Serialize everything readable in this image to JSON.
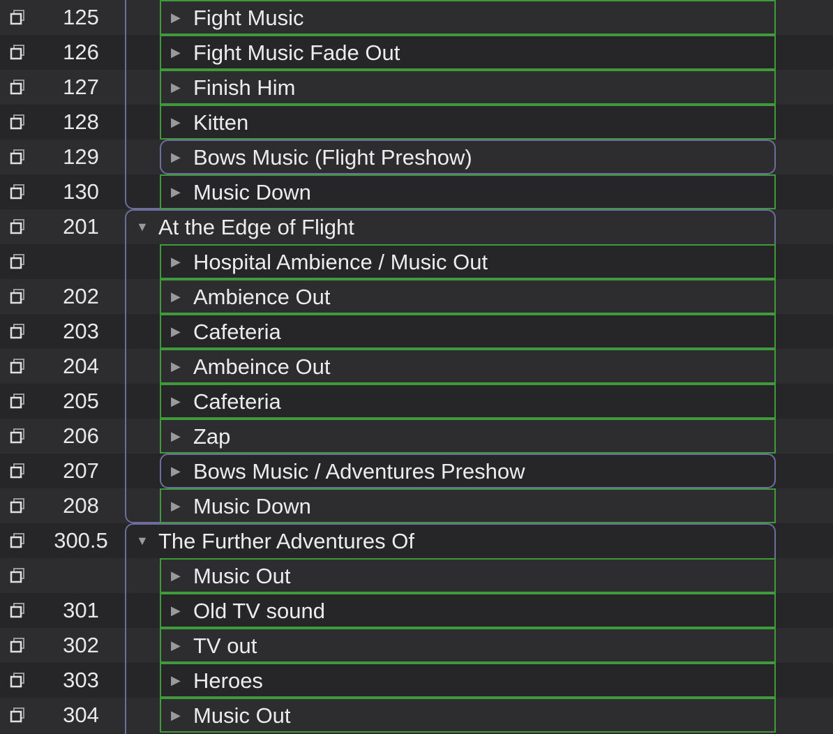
{
  "cues": [
    {
      "number": "125",
      "name": "Fight Music",
      "kind": "child",
      "expanded": false
    },
    {
      "number": "126",
      "name": "Fight Music Fade Out",
      "kind": "child",
      "expanded": false
    },
    {
      "number": "127",
      "name": "Finish Him",
      "kind": "child",
      "expanded": false
    },
    {
      "number": "128",
      "name": "Kitten",
      "kind": "child",
      "expanded": false
    },
    {
      "number": "129",
      "name": "Bows Music (Flight Preshow)",
      "kind": "nested-group",
      "expanded": false
    },
    {
      "number": "130",
      "name": "Music Down",
      "kind": "child",
      "expanded": false
    },
    {
      "number": "201",
      "name": "At the Edge of Flight",
      "kind": "group-header",
      "expanded": true
    },
    {
      "number": "",
      "name": "Hospital Ambience / Music Out",
      "kind": "child",
      "expanded": false
    },
    {
      "number": "202",
      "name": "Ambience Out",
      "kind": "child",
      "expanded": false
    },
    {
      "number": "203",
      "name": "Cafeteria",
      "kind": "child",
      "expanded": false
    },
    {
      "number": "204",
      "name": "Ambeince Out",
      "kind": "child",
      "expanded": false
    },
    {
      "number": "205",
      "name": "Cafeteria",
      "kind": "child",
      "expanded": false
    },
    {
      "number": "206",
      "name": "Zap",
      "kind": "child",
      "expanded": false
    },
    {
      "number": "207",
      "name": "Bows Music / Adventures Preshow",
      "kind": "nested-group",
      "expanded": false
    },
    {
      "number": "208",
      "name": "Music Down",
      "kind": "child",
      "expanded": false
    },
    {
      "number": "300.5",
      "name": "The Further Adventures Of",
      "kind": "group-header",
      "expanded": true
    },
    {
      "number": "",
      "name": "Music Out",
      "kind": "child",
      "expanded": false
    },
    {
      "number": "301",
      "name": "Old TV sound",
      "kind": "child",
      "expanded": false
    },
    {
      "number": "302",
      "name": "TV out",
      "kind": "child",
      "expanded": false
    },
    {
      "number": "303",
      "name": "Heroes",
      "kind": "child",
      "expanded": false
    },
    {
      "number": "304",
      "name": "Music Out",
      "kind": "child",
      "expanded": false
    }
  ],
  "icons": {
    "group_cue": "group-cue-icon",
    "collapsed": "▶",
    "expanded": "▼"
  },
  "colors": {
    "child_outline": "#3f9a3c",
    "group_outline": "#6c6e9c",
    "text": "#ececec"
  }
}
